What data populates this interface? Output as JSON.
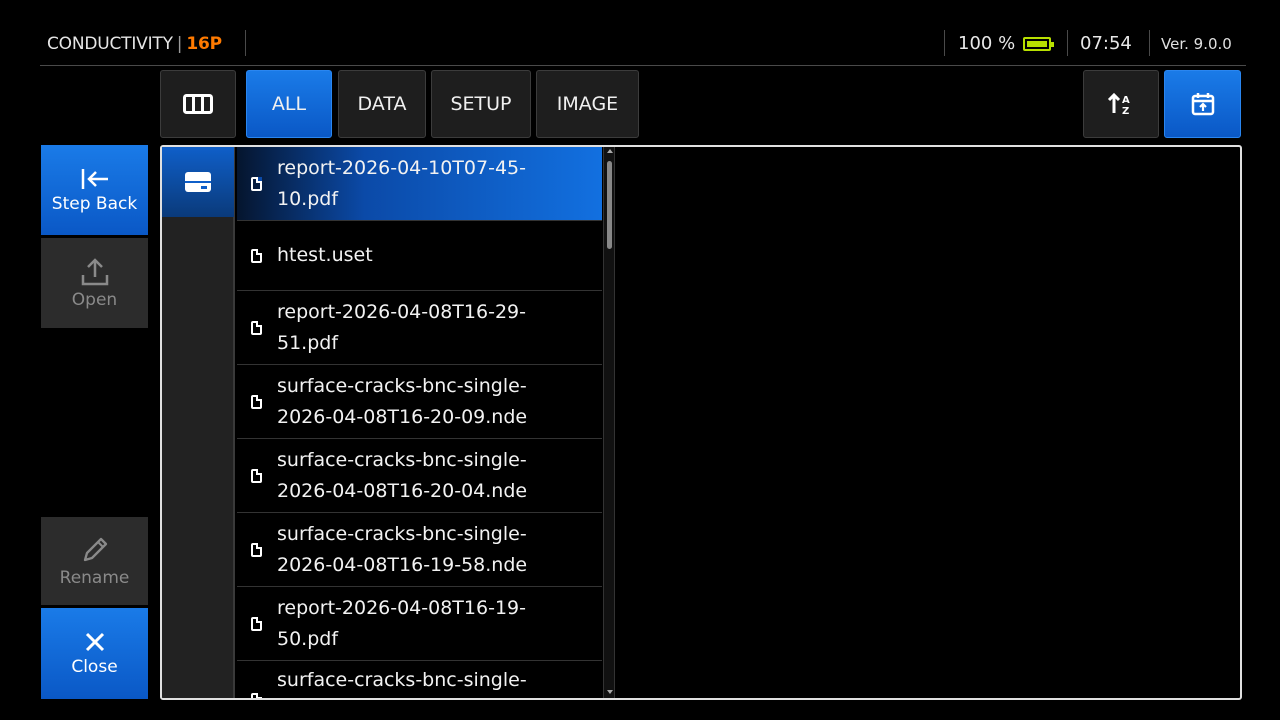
{
  "header": {
    "mode": "CONDUCTIVITY",
    "separator": "|",
    "probe": "16P",
    "battery": "100 %",
    "time": "07:54",
    "version": "Ver. 9.0.0"
  },
  "toolbar": {
    "filters": [
      {
        "label": "ALL",
        "active": true
      },
      {
        "label": "DATA",
        "active": false
      },
      {
        "label": "SETUP",
        "active": false
      },
      {
        "label": "IMAGE",
        "active": false
      }
    ]
  },
  "sidebar": {
    "step_back": "Step Back",
    "open": "Open",
    "rename": "Rename",
    "close": "Close"
  },
  "files": [
    {
      "name": "report-2026-04-10T07-45-\n10.pdf",
      "selected": true
    },
    {
      "name": "htest.uset",
      "selected": false
    },
    {
      "name": "report-2026-04-08T16-29-\n51.pdf",
      "selected": false
    },
    {
      "name": "surface-cracks-bnc-single-\n2026-04-08T16-20-09.nde",
      "selected": false
    },
    {
      "name": "surface-cracks-bnc-single-\n2026-04-08T16-20-04.nde",
      "selected": false
    },
    {
      "name": "surface-cracks-bnc-single-\n2026-04-08T16-19-58.nde",
      "selected": false
    },
    {
      "name": "report-2026-04-08T16-19-\n50.pdf",
      "selected": false
    },
    {
      "name": "surface-cracks-bnc-single-",
      "selected": false
    }
  ],
  "colors": {
    "accent": "#1270e0",
    "probe": "#ff7a00",
    "battery": "#b8e000"
  }
}
